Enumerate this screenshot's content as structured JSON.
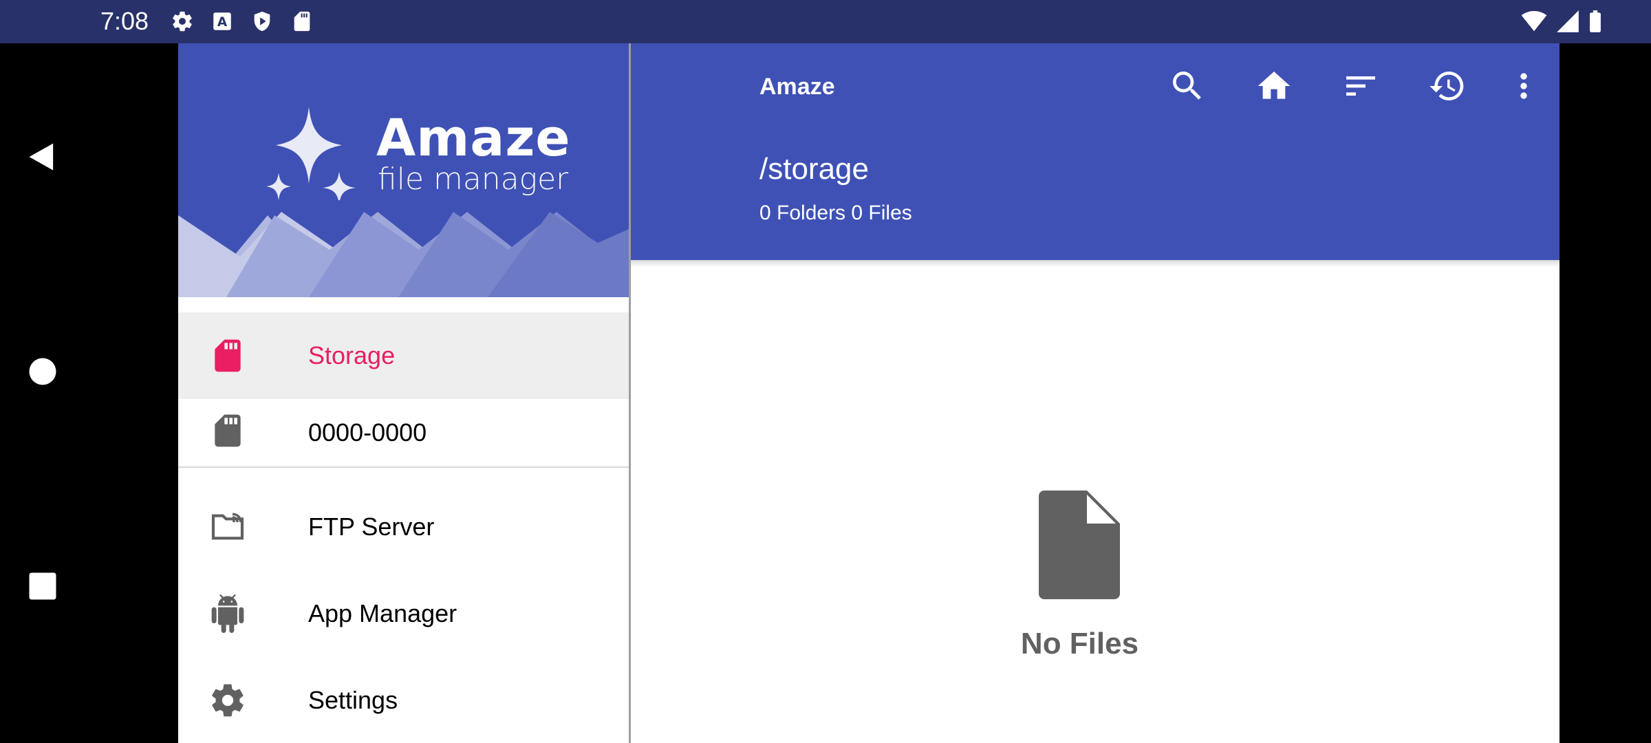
{
  "status_bar": {
    "time": "7:08",
    "left_icons": [
      "gear-icon",
      "a-box-icon",
      "shield-play-icon",
      "sd-card-icon"
    ],
    "right_icons": [
      "wifi-icon",
      "signal-icon",
      "battery-icon"
    ]
  },
  "system_nav": [
    "back-icon",
    "home-icon",
    "recents-icon"
  ],
  "drawer": {
    "logo_title": "Amaze",
    "logo_subtitle": "file manager",
    "items": [
      {
        "label": "Storage",
        "icon": "sd-card-icon",
        "selected": true
      },
      {
        "label": "0000-0000",
        "icon": "sd-card-icon",
        "selected": false
      },
      {
        "label": "FTP Server",
        "icon": "ftp-folder-icon",
        "selected": false
      },
      {
        "label": "App Manager",
        "icon": "android-icon",
        "selected": false
      },
      {
        "label": "Settings",
        "icon": "gear-icon",
        "selected": false
      }
    ]
  },
  "toolbar": {
    "title": "Amaze",
    "actions": [
      "search-icon",
      "home-icon",
      "sort-icon",
      "history-icon",
      "more-vert-icon"
    ]
  },
  "path": {
    "title": "/storage",
    "summary": "0 Folders 0 Files"
  },
  "empty_state": {
    "icon": "file-icon",
    "text": "No Files"
  },
  "fab": {
    "icon": "plus-icon"
  },
  "colors": {
    "primary": "#3f51b5",
    "accent": "#e91e63",
    "status_bar": "#283169",
    "icon_grey": "#616161"
  }
}
